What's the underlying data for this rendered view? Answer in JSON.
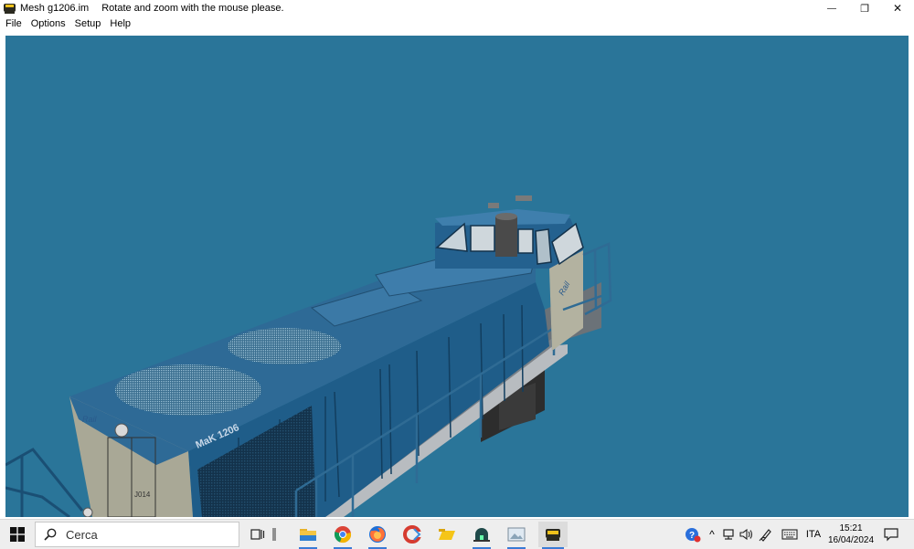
{
  "window": {
    "title": "Mesh g1206.im",
    "message": "Rotate and zoom with the mouse please.",
    "app_icon": "locomotive-icon",
    "controls": {
      "minimize": "—",
      "restore": "❐",
      "close": "✕"
    }
  },
  "menu": {
    "items": [
      "File",
      "Options",
      "Setup",
      "Help"
    ]
  },
  "viewport": {
    "background": "#2a7599",
    "model_label": "MaK 1206"
  },
  "taskbar": {
    "search_placeholder": "Cerca",
    "pinned_icons": [
      "task-view-icon",
      "separator-icon",
      "file-explorer-icon",
      "chrome-icon",
      "firefox-icon",
      "ccleaner-icon",
      "folder-icon",
      "dome-app-icon",
      "photos-icon",
      "locomotive-app-icon"
    ],
    "tray": {
      "language": "ITA",
      "time": "15:21",
      "date": "16/04/2024"
    }
  }
}
